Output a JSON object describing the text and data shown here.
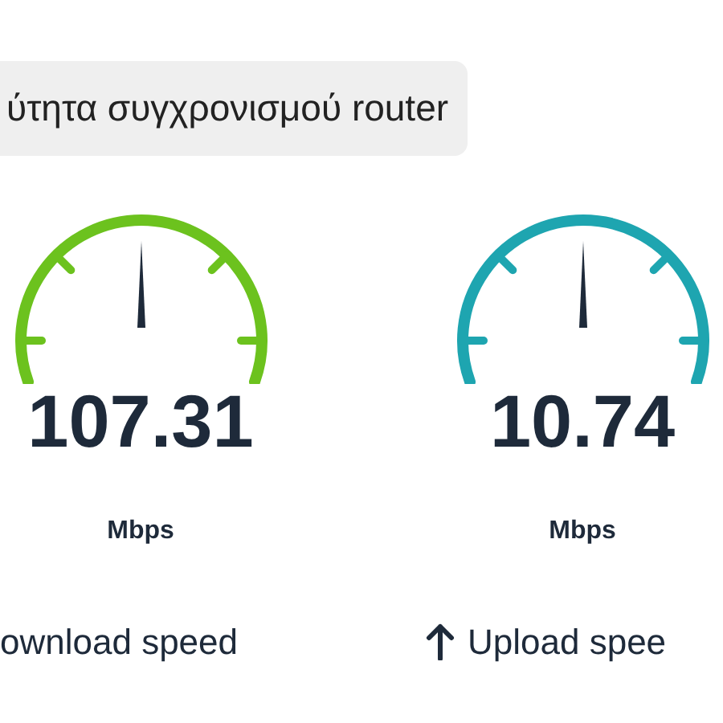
{
  "header": {
    "title": "ύτητα συγχρονισμού router"
  },
  "gauges": [
    {
      "value": "107.31",
      "unit": "Mbps",
      "label": "ownload speed",
      "color": "#6cc21e",
      "arrow_shown": false
    },
    {
      "value": "10.74",
      "unit": "Mbps",
      "label": "Upload spee",
      "color": "#1ea5b0",
      "arrow_shown": true
    }
  ]
}
